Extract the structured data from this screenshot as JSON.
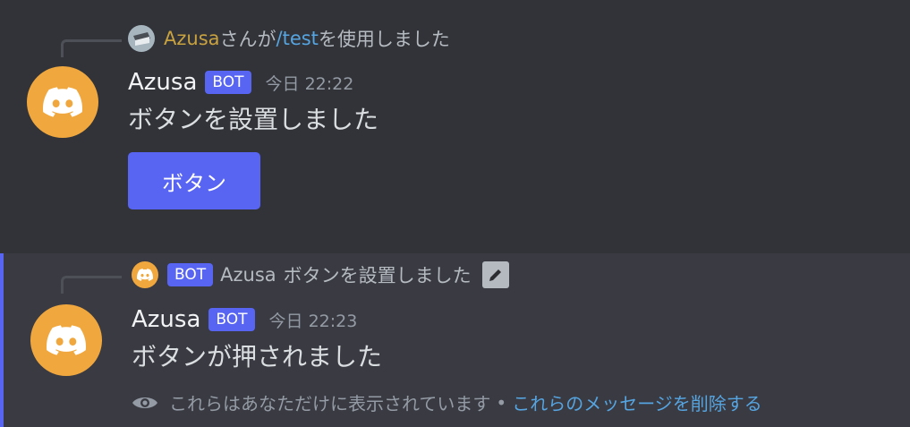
{
  "colors": {
    "background": "#313338",
    "highlight_background": "#393a42",
    "highlight_border": "#5865f2",
    "bot_tag": "#5865f2",
    "button": "#5865f2",
    "avatar_bot": "#f0a83e",
    "command_link": "#56a4e0",
    "invoker_name": "#c9a240"
  },
  "messages": [
    {
      "reply": {
        "avatar_icon": "user-avatar-icon",
        "user_name": "Azusa",
        "middle_text": "さんが",
        "command": "/test",
        "suffix": "を使用しました"
      },
      "avatar_icon": "discord-logo-icon",
      "author": "Azusa",
      "bot_tag": "BOT",
      "timestamp": "今日 22:22",
      "content": "ボタンを設置しました",
      "button_label": "ボタン"
    },
    {
      "reply": {
        "avatar_icon": "discord-logo-icon",
        "bot_tag": "BOT",
        "author": "Azusa",
        "text": "ボタンを設置しました",
        "edit_icon": "pencil-icon"
      },
      "avatar_icon": "discord-logo-icon",
      "author": "Azusa",
      "bot_tag": "BOT",
      "timestamp": "今日 22:23",
      "content": "ボタンが押されました",
      "ephemeral": {
        "icon": "eye-icon",
        "text": "これらはあなただけに表示されています",
        "separator": "•",
        "dismiss": "これらのメッセージを削除する"
      }
    }
  ]
}
